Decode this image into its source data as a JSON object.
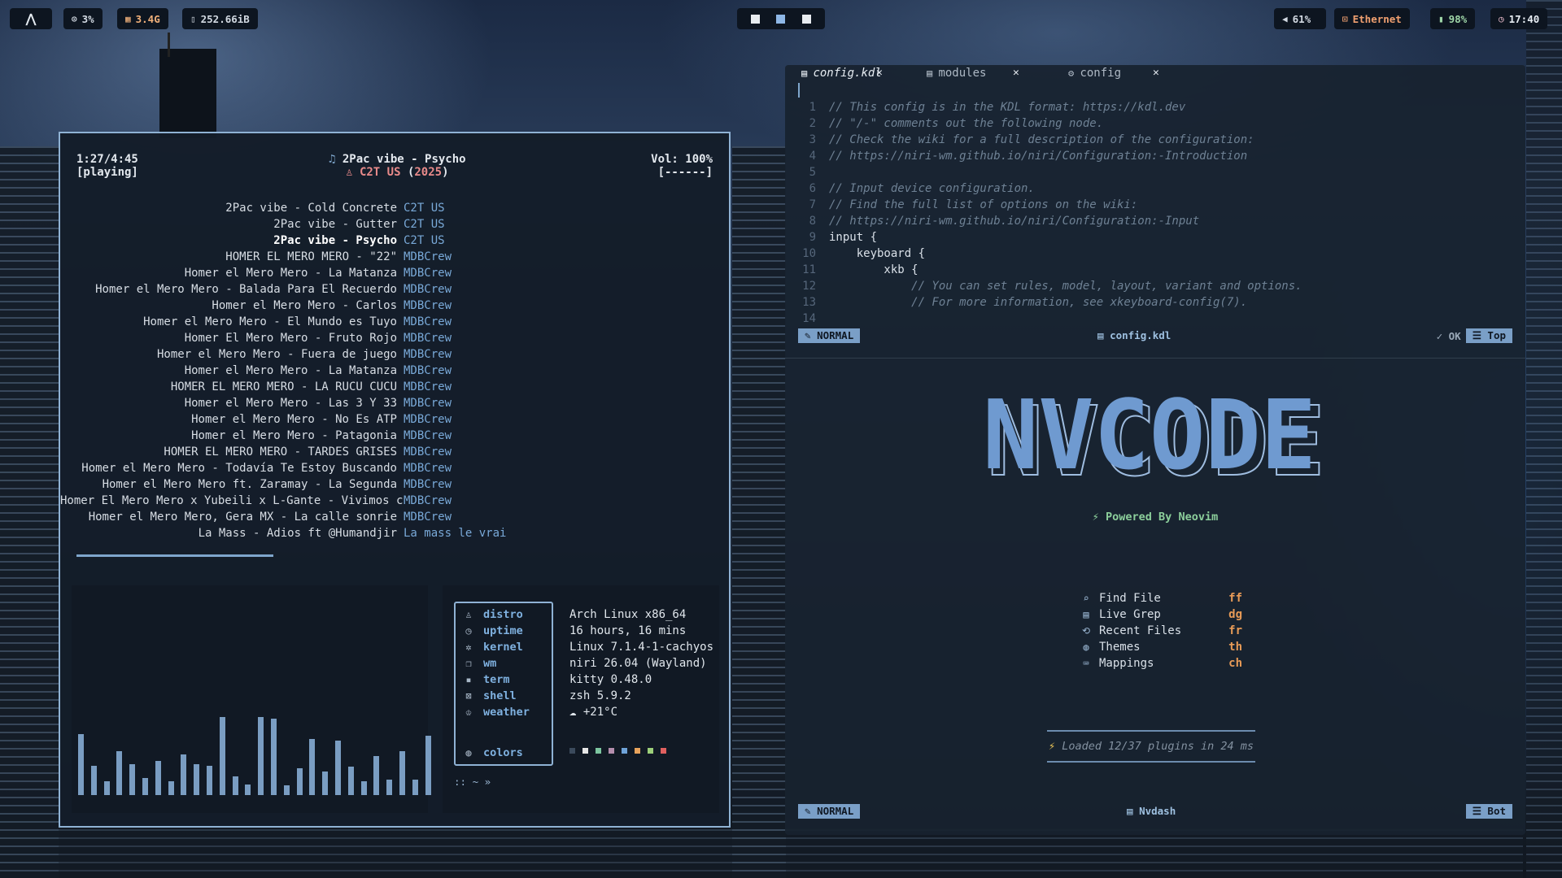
{
  "topbar": {
    "launcher_icon": "arch-logo",
    "cpu": "3%",
    "ram": "3.4G",
    "disk": "252.66iB",
    "workspaces": 3,
    "volume": "61%",
    "network": "Ethernet",
    "battery": "98%",
    "clock": "17:40"
  },
  "music": {
    "time": "1:27/4:45",
    "state": "[playing]",
    "title": "2Pac vibe - Psycho",
    "artist": "C2T US",
    "year": "2025",
    "volume": "Vol: 100%",
    "flags": "[------]",
    "progress": 0.31,
    "playlist": [
      {
        "title": "2Pac vibe - Cold Concrete",
        "artist": "C2T US"
      },
      {
        "title": "2Pac vibe - Gutter",
        "artist": "C2T US"
      },
      {
        "title": "2Pac vibe - Psycho",
        "artist": "C2T US",
        "current": true
      },
      {
        "title": "HOMER EL MERO MERO  - \"22\"",
        "artist": "MDBCrew"
      },
      {
        "title": "Homer el Mero Mero -  La Matanza",
        "artist": "MDBCrew"
      },
      {
        "title": "Homer el Mero Mero - Balada Para El Recuerdo",
        "artist": "MDBCrew"
      },
      {
        "title": "Homer el Mero Mero - Carlos",
        "artist": "MDBCrew"
      },
      {
        "title": "Homer el Mero Mero - El Mundo es Tuyo",
        "artist": "MDBCrew"
      },
      {
        "title": "Homer El Mero Mero - Fruto Rojo",
        "artist": "MDBCrew"
      },
      {
        "title": "Homer el Mero Mero - Fuera de juego",
        "artist": "MDBCrew"
      },
      {
        "title": "Homer el Mero Mero -  La Matanza",
        "artist": "MDBCrew"
      },
      {
        "title": "HOMER EL MERO MERO - LA RUCU CUCU",
        "artist": "MDBCrew"
      },
      {
        "title": "Homer el Mero Mero - Las 3 Y 33",
        "artist": "MDBCrew"
      },
      {
        "title": "Homer el Mero Mero - No Es ATP",
        "artist": "MDBCrew"
      },
      {
        "title": "Homer el Mero Mero - Patagonia",
        "artist": "MDBCrew"
      },
      {
        "title": "HOMER EL MERO MERO - TARDES GRISES",
        "artist": "MDBCrew"
      },
      {
        "title": "Homer el Mero Mero - Todavía Te Estoy Buscando",
        "artist": "MDBCrew"
      },
      {
        "title": "Homer el Mero Mero ft. Zaramay - La Segunda",
        "artist": "MDBCrew"
      },
      {
        "title": "Homer El Mero Mero x Yubeili x L-Gante - Vivimos c",
        "artist": "MDBCrew"
      },
      {
        "title": "Homer el Mero Mero, Gera MX - La calle sonrie",
        "artist": "MDBCrew"
      },
      {
        "title": "La Mass - Adios ft @Humandjir",
        "artist": "La mass le vrai"
      }
    ],
    "visualizer": [
      0.78,
      0.38,
      0.18,
      0.56,
      0.4,
      0.22,
      0.44,
      0.18,
      0.52,
      0.4,
      0.38,
      1.0,
      0.24,
      0.14,
      1.0,
      0.98,
      0.12,
      0.34,
      0.72,
      0.3,
      0.7,
      0.36,
      0.18,
      0.5,
      0.2,
      0.56,
      0.2,
      0.76
    ]
  },
  "fastfetch": {
    "rows": [
      {
        "key": "distro",
        "icon": "penguin-icon",
        "value": "Arch Linux x86_64"
      },
      {
        "key": "uptime",
        "icon": "clock-icon",
        "value": "16 hours, 16 mins"
      },
      {
        "key": "kernel",
        "icon": "gear-icon",
        "value": "Linux 7.1.4-1-cachyos"
      },
      {
        "key": "wm",
        "icon": "window-icon",
        "value": "niri 26.04 (Wayland)"
      },
      {
        "key": "term",
        "icon": "terminal-icon",
        "value": "kitty 0.48.0"
      },
      {
        "key": "shell",
        "icon": "shell-icon",
        "value": "zsh 5.9.2"
      },
      {
        "key": "weather",
        "icon": "weather-icon",
        "value": "+21°C"
      }
    ],
    "colors_key": "colors",
    "swatches": [
      "#3b4a5c",
      "#e6e6e6",
      "#7dc6a0",
      "#b48ead",
      "#6fa3d8",
      "#e8a35c",
      "#9ccf7a",
      "#e0605f"
    ],
    "prompt": ":: ~ »"
  },
  "editor": {
    "tabs": [
      {
        "label": "config.kdl",
        "active": true
      },
      {
        "label": "modules"
      },
      {
        "label": "config"
      }
    ],
    "code": [
      {
        "n": "1",
        "text": "// This config is in the KDL format: https://kdl.dev",
        "comment": true
      },
      {
        "n": "2",
        "text": "// \"/-\" comments out the following node.",
        "comment": true
      },
      {
        "n": "3",
        "text": "// Check the wiki for a full description of the configuration:",
        "comment": true
      },
      {
        "n": "4",
        "text": "// https://niri-wm.github.io/niri/Configuration:-Introduction",
        "comment": true
      },
      {
        "n": "5",
        "text": ""
      },
      {
        "n": "6",
        "text": "// Input device configuration.",
        "comment": true
      },
      {
        "n": "7",
        "text": "// Find the full list of options on the wiki:",
        "comment": true
      },
      {
        "n": "8",
        "text": "// https://niri-wm.github.io/niri/Configuration:-Input",
        "comment": true
      },
      {
        "n": "9",
        "text": "input {"
      },
      {
        "n": "10",
        "text": "    keyboard {"
      },
      {
        "n": "11",
        "text": "        xkb {"
      },
      {
        "n": "12",
        "text": "            // You can set rules, model, layout, variant and options.",
        "comment": true
      },
      {
        "n": "13",
        "text": "            // For more information, see xkeyboard-config(7).",
        "comment": true
      },
      {
        "n": "14",
        "text": ""
      }
    ],
    "status1": {
      "mode": "NORMAL",
      "file": "config.kdl",
      "ok": "OK",
      "pos": "Top"
    },
    "dashboard": {
      "logo": "NVCODE",
      "powered_prefix": "Powered By",
      "powered_name": "eovim",
      "menu": [
        {
          "label": "Find File",
          "key": "ff",
          "icon": "search-icon"
        },
        {
          "label": "Live Grep",
          "key": "dg",
          "icon": "grep-icon"
        },
        {
          "label": "Recent Files",
          "key": "fr",
          "icon": "history-icon"
        },
        {
          "label": "Themes",
          "key": "th",
          "icon": "palette-icon"
        },
        {
          "label": "Mappings",
          "key": "ch",
          "icon": "keyboard-icon"
        }
      ],
      "loaded": "Loaded 12/37 plugins in 24 ms"
    },
    "status2": {
      "mode": "NORMAL",
      "file": "Nvdash",
      "pos": "Bot"
    }
  }
}
